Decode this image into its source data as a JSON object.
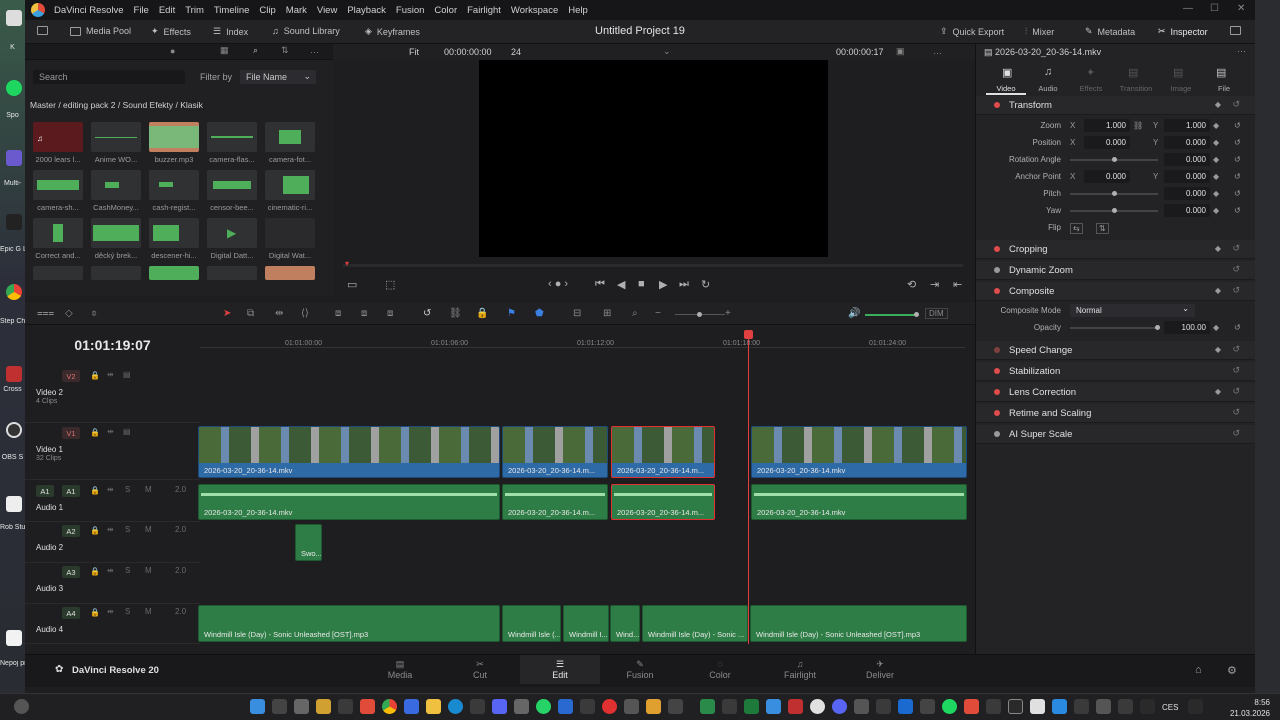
{
  "desktop": {
    "labels": [
      "K",
      "Spo",
      "Multi-",
      "Epic G Laur",
      "Step Chro",
      "Cross",
      "OBS S",
      "Rob Stud",
      "Nepoj proje"
    ]
  },
  "menubar": {
    "app_name": "DaVinci Resolve",
    "items": [
      "File",
      "Edit",
      "Trim",
      "Timeline",
      "Clip",
      "Mark",
      "View",
      "Playback",
      "Fusion",
      "Color",
      "Fairlight",
      "Workspace",
      "Help"
    ]
  },
  "toolbar": {
    "media_pool": "Media Pool",
    "effects": "Effects",
    "index": "Index",
    "sound_library": "Sound Library",
    "keyframes": "Keyframes",
    "project_title": "Untitled Project 19",
    "quick_export": "Quick Export",
    "mixer": "Mixer",
    "metadata": "Metadata",
    "inspector": "Inspector"
  },
  "media_pool": {
    "search_placeholder": "Search",
    "filter_label": "Filter by",
    "filter_value": "File Name",
    "path": "Master / editing pack 2 / Sound Efekty / Klasik",
    "clips": [
      "2000 lears l...",
      "Anime WO...",
      "buzzer.mp3",
      "camera-flas...",
      "camera-fot...",
      "camera-sh...",
      "CashMoney...",
      "cash-regist...",
      "censor-bee...",
      "cinematic-ri...",
      "Correct and...",
      "děcký brek...",
      "descener-hi...",
      "Digital Datt...",
      "Digital Wat..."
    ]
  },
  "viewer": {
    "fit": "Fit",
    "source_tc": "00:00:00:00",
    "fps": "24",
    "timeline_tc": "00:00:00:17",
    "clip_name": "2026-03-20_20-36-14.mkv"
  },
  "inspector": {
    "tabs": [
      "Video",
      "Audio",
      "Effects",
      "Transition",
      "Image",
      "File"
    ],
    "sections": {
      "transform": "Transform",
      "cropping": "Cropping",
      "dynamic_zoom": "Dynamic Zoom",
      "composite": "Composite",
      "speed_change": "Speed Change",
      "stabilization": "Stabilization",
      "lens_correction": "Lens Correction",
      "retime": "Retime and Scaling",
      "ai_super_scale": "AI Super Scale"
    },
    "params": {
      "zoom_label": "Zoom",
      "zoom_x": "1.000",
      "zoom_y": "1.000",
      "position_label": "Position",
      "pos_x": "0.000",
      "pos_y": "0.000",
      "rotation_label": "Rotation Angle",
      "rotation": "0.000",
      "anchor_label": "Anchor Point",
      "anchor_x": "0.000",
      "anchor_y": "0.000",
      "pitch_label": "Pitch",
      "pitch": "0.000",
      "yaw_label": "Yaw",
      "yaw": "0.000",
      "flip_label": "Flip",
      "composite_mode_label": "Composite Mode",
      "composite_mode": "Normal",
      "opacity_label": "Opacity",
      "opacity": "100.00",
      "x": "X",
      "y": "Y"
    }
  },
  "timeline": {
    "timecode": "01:01:19:07",
    "ruler": [
      "01:01:00:00",
      "01:01:06:00",
      "01:01:12:00",
      "01:01:18:00",
      "01:01:24:00"
    ],
    "dim": "DIM",
    "tracks": {
      "v2": {
        "badge": "V2",
        "name": "Video 2",
        "clips": "4 Clips"
      },
      "v1": {
        "badge": "V1",
        "name": "Video 1",
        "clips": "32 Clips"
      },
      "a1": {
        "badge": "A1",
        "name": "Audio 1",
        "level": "2.0"
      },
      "a2": {
        "badge": "A2",
        "name": "Audio 2",
        "level": "2.0"
      },
      "a3": {
        "badge": "A3",
        "name": "Audio 3",
        "level": "2.0"
      },
      "a4": {
        "badge": "A4",
        "name": "Audio 4",
        "level": "2.0"
      }
    },
    "clip_labels": {
      "video": "2026-03-20_20-36-14.mkv",
      "video_short": "2026-03-20_20-36-14.m...",
      "sfx": "Swo...",
      "music": "Windmill Isle (Day) - Sonic Unleashed [OST].mp3",
      "music_a": "Windmill Isle (...",
      "music_b": "Windmill I...",
      "music_c": "Wind...",
      "music_d": "Windmill Isle (Day) - Sonic ..."
    }
  },
  "pages": {
    "brand": "DaVinci Resolve 20",
    "tabs": [
      "Media",
      "Cut",
      "Edit",
      "Fusion",
      "Color",
      "Fairlight",
      "Deliver"
    ],
    "active": "Edit"
  },
  "taskbar": {
    "lang": "CES",
    "time": "8:56",
    "date": "21.03.2026"
  },
  "colors": {
    "accent_red": "#e04040",
    "video_clip": "#2e6aa6",
    "audio_clip": "#2f7d46"
  }
}
